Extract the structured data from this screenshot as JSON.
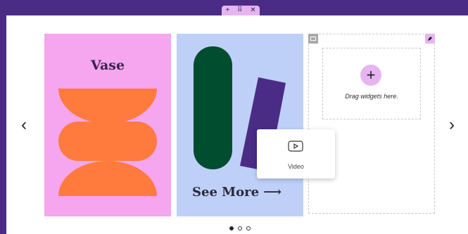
{
  "toolbar": {
    "add_icon": "plus-icon",
    "drag_icon": "drag-handle-icon",
    "close_icon": "close-icon"
  },
  "carousel": {
    "slides": [
      {
        "title": "Vase",
        "background": "#f5a6ee",
        "shape_color": "#ff7a3d"
      },
      {
        "title": "See More ⟶",
        "background": "#bfd0f8",
        "shape_colors": [
          "#004d30",
          "#4a2c86"
        ]
      }
    ],
    "empty_slide": {
      "drop_text": "Drag widgets here.",
      "add_icon": "plus-icon",
      "image_icon": "image-icon",
      "edit_icon": "pencil-icon"
    },
    "prev_arrow": "‹",
    "next_arrow": "›",
    "active_dot": 0,
    "dot_count": 3
  },
  "widget_popover": {
    "label": "Video",
    "icon": "video-play-icon"
  },
  "colors": {
    "frame_bg": "#4a2c86",
    "accent": "#e7b4f2"
  }
}
